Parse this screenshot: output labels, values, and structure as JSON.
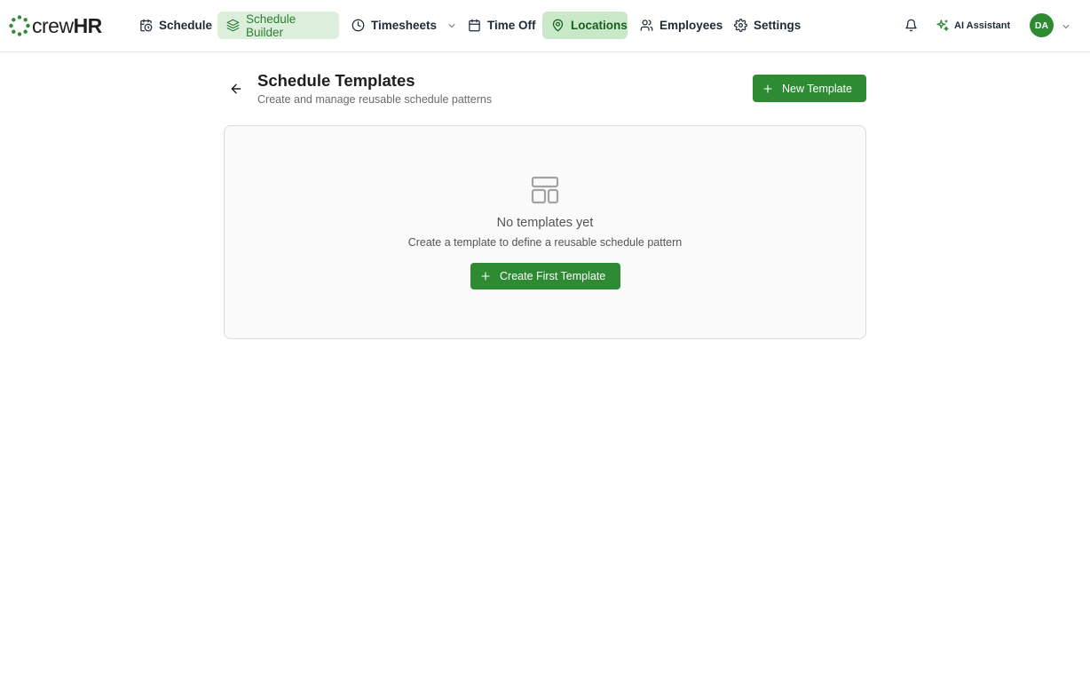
{
  "brand": {
    "name_light": "crew",
    "name_bold": "HR",
    "color": "#2e8b34"
  },
  "nav": {
    "items": [
      {
        "label": "Schedule",
        "icon": "calendar-clock-icon"
      },
      {
        "label": "Schedule Builder",
        "icon": "layers-icon"
      },
      {
        "label": "Timesheets",
        "icon": "clock-icon"
      },
      {
        "label": "Time Off",
        "icon": "calendar-icon"
      },
      {
        "label": "Locations",
        "icon": "map-pin-icon"
      },
      {
        "label": "Employees",
        "icon": "users-icon"
      },
      {
        "label": "Settings",
        "icon": "gear-icon"
      }
    ]
  },
  "header_right": {
    "ai_label": "AI Assistant",
    "avatar_initials": "DA"
  },
  "page": {
    "title": "Schedule Templates",
    "subtitle": "Create and manage reusable schedule patterns",
    "new_template_label": "New Template"
  },
  "empty_state": {
    "title": "No templates yet",
    "description": "Create a template to define a reusable schedule pattern",
    "button_label": "Create First Template"
  },
  "colors": {
    "accent": "#2e8b34",
    "nav_active_bg": "#c8e8c8",
    "nav_builder_bg": "#dcefdc"
  }
}
